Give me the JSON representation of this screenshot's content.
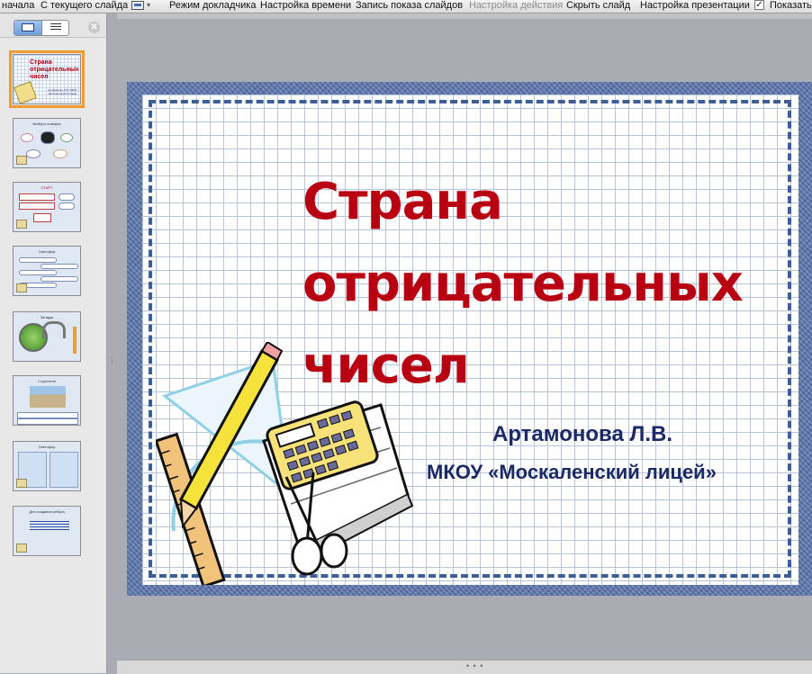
{
  "ribbon": {
    "items": [
      {
        "label": "начала",
        "disabled": false
      },
      {
        "label": "С текущего слайда",
        "disabled": false
      },
      {
        "label": "Режим докладчика",
        "disabled": false
      },
      {
        "label": "Настройка времени",
        "disabled": false
      },
      {
        "label": "Запись показа слайдов",
        "disabled": false
      },
      {
        "label": "Настройка действия",
        "disabled": true
      },
      {
        "label": "Скрыть слайд",
        "disabled": false
      },
      {
        "label": "Настройка презентации",
        "disabled": false
      },
      {
        "label": "Показать",
        "disabled": false
      }
    ],
    "checkbox_checked": true,
    "check_glyph": "✓",
    "dropdown_glyph": "▾"
  },
  "left_panel": {
    "close_glyph": "✕",
    "thumbnails": [
      {
        "title": "Страна отрицательных чисел",
        "subtitle": "Артамонова Л.В. МКОУ «Москаленский лицей»",
        "selected": true
      },
      {
        "title": "Выбери станцию",
        "selected": false
      },
      {
        "title": "СТАРТ",
        "selected": false
      },
      {
        "title": "Светофор",
        "selected": false
      },
      {
        "title": "Загадки",
        "selected": false
      },
      {
        "title": "Строители",
        "selected": false
      },
      {
        "title": "Светофор",
        "selected": false
      },
      {
        "title": "Для создания ребуса",
        "selected": false
      }
    ]
  },
  "slide": {
    "title_lines": [
      "Страна",
      "отрицательных",
      "чисел"
    ],
    "author": "Артамонова Л.В.",
    "school": "МКОУ «Москаленский лицей»"
  },
  "grip": "• • •",
  "grip_vertical": "⋮",
  "colors": {
    "title": "#b90012",
    "subtitle": "#1b2a66",
    "frame": "#3c5f99",
    "selection": "#f09b2e"
  }
}
